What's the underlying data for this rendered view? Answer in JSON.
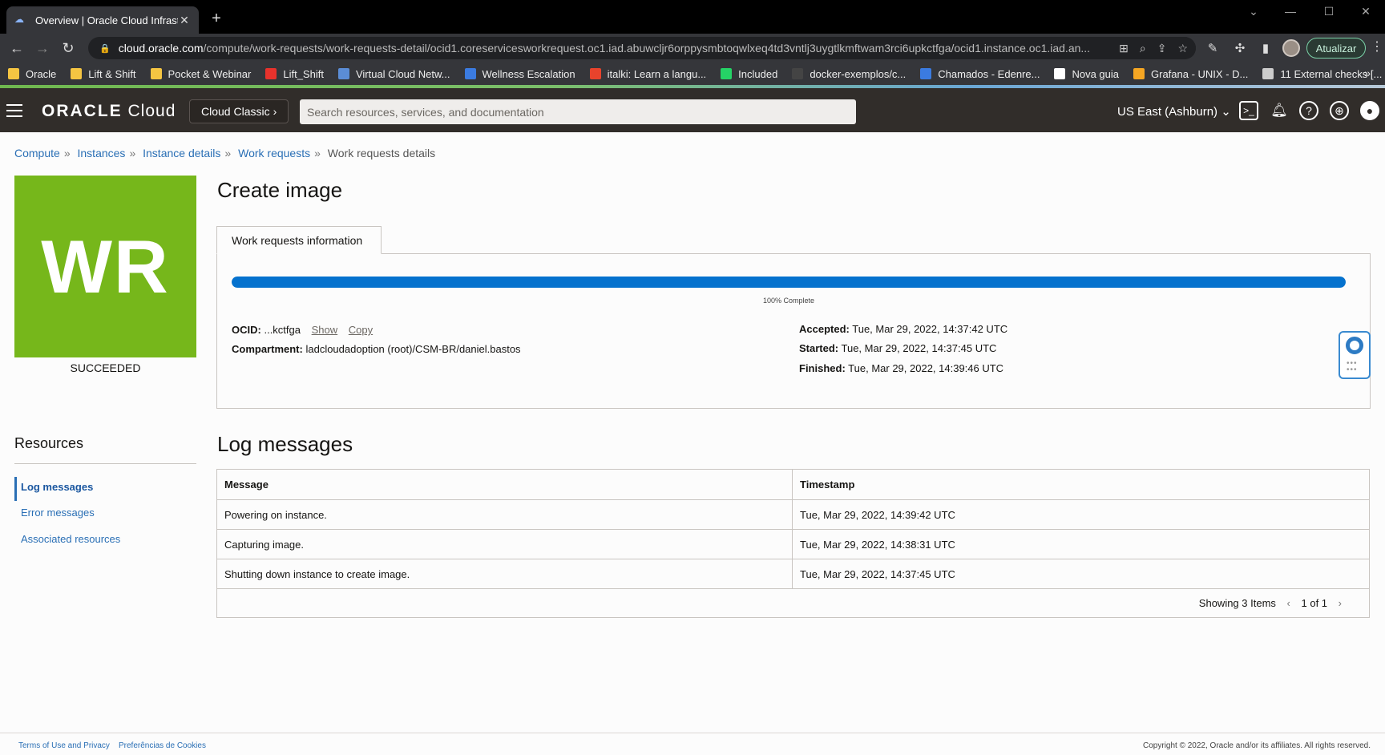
{
  "browser": {
    "tab_title": "Overview | Oracle Cloud Infrastru",
    "url_host": "cloud.oracle.com",
    "url_path": "/compute/work-requests/work-requests-detail/ocid1.coreservicesworkrequest.oc1.iad.abuwcljr6orppysmbtoqwlxeq4td3vntlj3uygtlkmftwam3rci6upkctfga/ocid1.instance.oc1.iad.an...",
    "update_label": "Atualizar",
    "bookmarks": [
      {
        "label": "Oracle",
        "color": "#f5c542"
      },
      {
        "label": "Lift & Shift",
        "color": "#f5c542"
      },
      {
        "label": "Pocket & Webinar",
        "color": "#f5c542"
      },
      {
        "label": "Lift_Shift",
        "color": "#e8322c"
      },
      {
        "label": "Virtual Cloud Netw...",
        "color": "#5b8dd6"
      },
      {
        "label": "Wellness Escalation",
        "color": "#3b7be0"
      },
      {
        "label": "italki: Learn a langu...",
        "color": "#e8432c"
      },
      {
        "label": "Included",
        "color": "#25d366"
      },
      {
        "label": "docker-exemplos/c...",
        "color": "#444444"
      },
      {
        "label": "Chamados - Edenre...",
        "color": "#3b7be0"
      },
      {
        "label": "Nova guia",
        "color": "#ffffff"
      },
      {
        "label": "Grafana - UNIX - D...",
        "color": "#f5a623"
      },
      {
        "label": "11 External checks [...",
        "color": "#cccccc"
      }
    ]
  },
  "header": {
    "logo_main": "ORACLE",
    "logo_sub": "Cloud",
    "classic_label": "Cloud Classic",
    "search_placeholder": "Search resources, services, and documentation",
    "region": "US East (Ashburn)"
  },
  "breadcrumb": {
    "items": [
      "Compute",
      "Instances",
      "Instance details",
      "Work requests"
    ],
    "current": "Work requests details",
    "separator": "»"
  },
  "work_request": {
    "badge": "WR",
    "badge_color": "#76b71b",
    "status": "SUCCEEDED",
    "title": "Create image",
    "tab_label": "Work requests information",
    "progress": 100,
    "progress_label": "100% Complete",
    "ocid_label": "OCID:",
    "ocid_value": "...kctfga",
    "show_label": "Show",
    "copy_label": "Copy",
    "compartment_label": "Compartment:",
    "compartment_value": "ladcloudadoption (root)/CSM-BR/daniel.bastos",
    "accepted_label": "Accepted:",
    "accepted_value": "Tue, Mar 29, 2022, 14:37:42 UTC",
    "started_label": "Started:",
    "started_value": "Tue, Mar 29, 2022, 14:37:45 UTC",
    "finished_label": "Finished:",
    "finished_value": "Tue, Mar 29, 2022, 14:39:46 UTC"
  },
  "resources": {
    "title": "Resources",
    "items": [
      "Log messages",
      "Error messages",
      "Associated resources"
    ]
  },
  "log": {
    "title": "Log messages",
    "columns": [
      "Message",
      "Timestamp"
    ],
    "rows": [
      {
        "message": "Powering on instance.",
        "timestamp": "Tue, Mar 29, 2022, 14:39:42 UTC"
      },
      {
        "message": "Capturing image.",
        "timestamp": "Tue, Mar 29, 2022, 14:38:31 UTC"
      },
      {
        "message": "Shutting down instance to create image.",
        "timestamp": "Tue, Mar 29, 2022, 14:37:45 UTC"
      }
    ],
    "showing": "Showing 3 Items",
    "page": "1 of 1"
  },
  "footer": {
    "terms": "Terms of Use and Privacy",
    "cookies": "Preferências de Cookies",
    "copyright": "Copyright © 2022, Oracle and/or its affiliates. All rights reserved."
  }
}
